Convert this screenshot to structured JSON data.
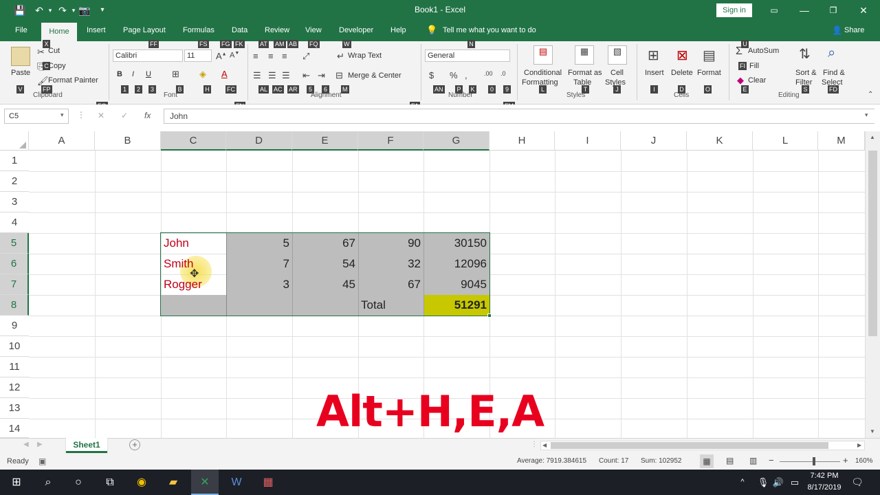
{
  "window": {
    "title": "Book1 - Excel",
    "signin": "Sign in"
  },
  "tabs": [
    {
      "id": "file",
      "label": "File"
    },
    {
      "id": "home",
      "label": "Home"
    },
    {
      "id": "insert",
      "label": "Insert"
    },
    {
      "id": "pagelayout",
      "label": "Page Layout"
    },
    {
      "id": "formulas",
      "label": "Formulas"
    },
    {
      "id": "data",
      "label": "Data"
    },
    {
      "id": "review",
      "label": "Review"
    },
    {
      "id": "view",
      "label": "View"
    },
    {
      "id": "developer",
      "label": "Developer"
    },
    {
      "id": "help",
      "label": "Help"
    }
  ],
  "tellme": "Tell me what you want to do",
  "share": "Share",
  "ribbon": {
    "paste": "Paste",
    "cut": "Cut",
    "copy": "Copy",
    "format_painter": "Format Painter",
    "clipboard": "Clipboard",
    "font_name": "Calibri",
    "font_size": "11",
    "font": "Font",
    "bold": "B",
    "italic": "I",
    "underline": "U",
    "wrap_text": "Wrap Text",
    "merge_center": "Merge & Center",
    "alignment": "Alignment",
    "number_format": "General",
    "number": "Number",
    "conditional_formatting_1": "Conditional",
    "conditional_formatting_2": "Formatting",
    "format_as_table_1": "Format as",
    "format_as_table_2": "Table",
    "cell_styles_1": "Cell",
    "cell_styles_2": "Styles",
    "styles": "Styles",
    "insert": "Insert",
    "delete": "Delete",
    "format": "Format",
    "cells": "Cells",
    "autosum": "AutoSum",
    "fill": "Fill",
    "clear": "Clear",
    "sort_filter_1": "Sort &",
    "sort_filter_2": "Filter",
    "find_select_1": "Find &",
    "find_select_2": "Select",
    "editing": "Editing"
  },
  "keytips": {
    "x": "X",
    "c": "C",
    "v": "V",
    "fp": "FP",
    "ff": "FF",
    "fs": "FS",
    "fg": "FG",
    "fk": "FK",
    "at": "AT",
    "am": "AM",
    "ab": "AB",
    "fq": "FQ",
    "w": "W",
    "n": "N",
    "b1": "1",
    "b2": "2",
    "b3": "3",
    "bb": "B",
    "h": "H",
    "fc": "FC",
    "al": "AL",
    "ac": "AC",
    "ar": "AR",
    "b5": "5",
    "b6": "6",
    "m": "M",
    "an": "AN",
    "p": "P",
    "k": "K",
    "b0": "0",
    "b9": "9",
    "l": "L",
    "t": "T",
    "j": "J",
    "i": "I",
    "d": "D",
    "o": "O",
    "u": "U",
    "fi": "FI",
    "e": "E",
    "s": "S",
    "fd": "FD",
    "fo": "FO",
    "fn": "FN",
    "fa": "FA",
    "fm": "FM"
  },
  "formula_bar": {
    "name_box": "C5",
    "fx": "fx",
    "cancel": "✕",
    "enter": "✓",
    "content": "John"
  },
  "columns": [
    "A",
    "B",
    "C",
    "D",
    "E",
    "F",
    "G",
    "H",
    "I",
    "J",
    "K",
    "L",
    "M"
  ],
  "rows": [
    "1",
    "2",
    "3",
    "4",
    "5",
    "6",
    "7",
    "8",
    "9",
    "10",
    "11",
    "12",
    "13",
    "14"
  ],
  "cells": {
    "r5": {
      "name": "John",
      "d": "5",
      "e": "67",
      "f": "90",
      "g": "30150"
    },
    "r6": {
      "name": "Smith",
      "d": "7",
      "e": "54",
      "f": "32",
      "g": "12096"
    },
    "r7": {
      "name": "Rogger",
      "d": "3",
      "e": "45",
      "f": "67",
      "g": "9045"
    },
    "r8": {
      "f": "Total",
      "g": "51291"
    }
  },
  "overlay_text": "Alt+H,E,A",
  "sheet_tab": "Sheet1",
  "status": {
    "ready": "Ready",
    "average": "Average: 7919.384615",
    "count": "Count: 17",
    "sum": "Sum: 102952",
    "zoom": "160%"
  },
  "taskbar": {
    "time": "7:42 PM",
    "date": "8/17/2019"
  },
  "colors": {
    "excel_green": "#217346",
    "name_red": "#c0001a",
    "selection_gray": "#bdbdbd",
    "total_highlight": "#c8c800",
    "overlay_red": "#e8001f"
  }
}
